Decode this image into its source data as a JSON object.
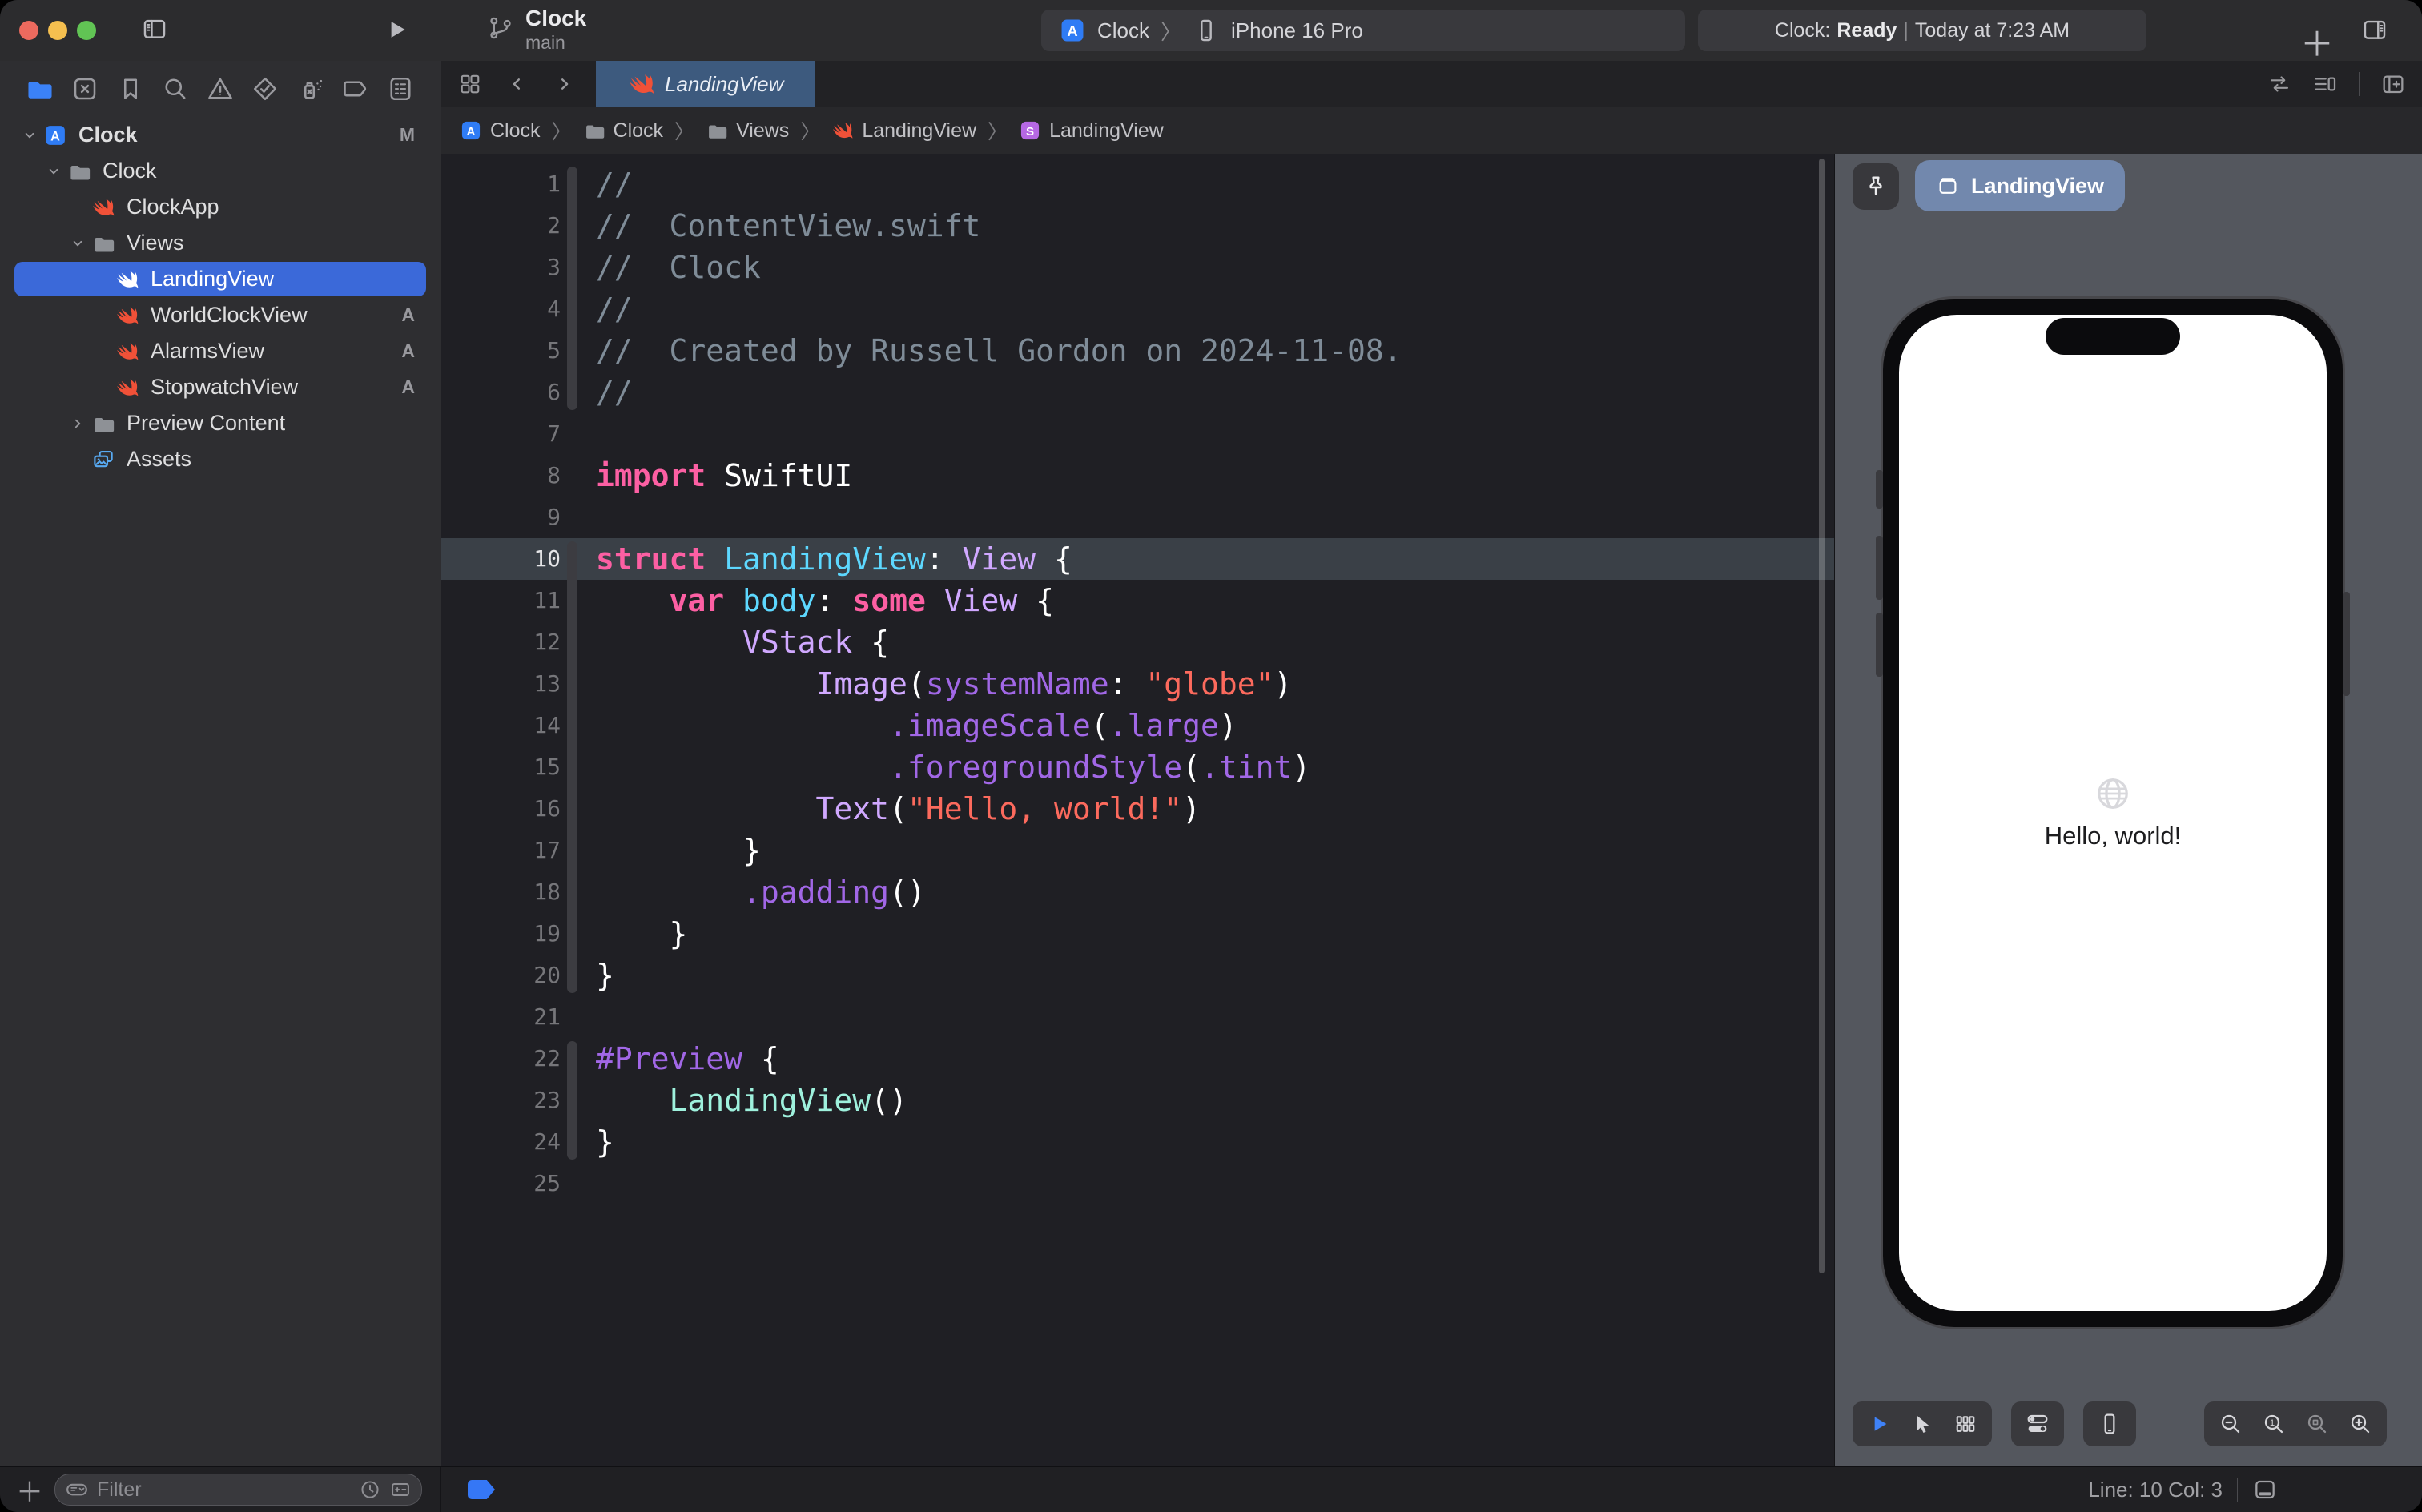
{
  "colors": {
    "syntax": {
      "com": "#7f8c98",
      "kw": "#fc5fa3",
      "decl": "#5dd8ff",
      "type": "#d0a8ff",
      "mem": "#a167e6",
      "str": "#fc6a5d",
      "proj": "#9ef1dd",
      "pl": "#ffffff",
      "ln": "#76767a",
      "ln_hl": "#e6e6e8"
    },
    "traffic": [
      "#ec6a5e",
      "#f5bf4f",
      "#61c454"
    ],
    "swift_orange": "#f05138",
    "folder_gray": "#8e9196",
    "app_blue": "#2f7cf5",
    "assets_blue": "#58aaf2",
    "struct_purple": "#b668e4",
    "selection_blue": "#3b69d9",
    "tab_active": "#3d5a7e",
    "chip_blue": "#7288ad",
    "play_blue": "#3f82f8",
    "globe_blue": "#3478f6"
  },
  "toolbar": {
    "project": "Clock",
    "branch": "main",
    "scheme_target": "Clock",
    "scheme_separator": "〉",
    "scheme_device": "iPhone 16 Pro",
    "status_app": "Clock:",
    "status_state": "Ready",
    "status_sep": "|",
    "status_detail": "Today at 7:23 AM"
  },
  "navigator": {
    "tabs": [
      {
        "name": "project-navigator",
        "active": true
      },
      {
        "name": "source-control-changes"
      },
      {
        "name": "bookmarks"
      },
      {
        "name": "find"
      },
      {
        "name": "issues"
      },
      {
        "name": "tests"
      },
      {
        "name": "debug-memory"
      },
      {
        "name": "breakpoints"
      },
      {
        "name": "reports"
      }
    ],
    "tree": [
      {
        "label": "Clock",
        "icon": "app-project",
        "depth": 0,
        "chevron": "down",
        "badge": "M"
      },
      {
        "label": "Clock",
        "icon": "folder",
        "depth": 1,
        "chevron": "down"
      },
      {
        "label": "ClockApp",
        "icon": "swift",
        "depth": 2
      },
      {
        "label": "Views",
        "icon": "folder",
        "depth": 2,
        "chevron": "down"
      },
      {
        "label": "LandingView",
        "icon": "swift",
        "depth": 3,
        "selected": true
      },
      {
        "label": "WorldClockView",
        "icon": "swift",
        "depth": 3,
        "badge": "A"
      },
      {
        "label": "AlarmsView",
        "icon": "swift",
        "depth": 3,
        "badge": "A"
      },
      {
        "label": "StopwatchView",
        "icon": "swift",
        "depth": 3,
        "badge": "A"
      },
      {
        "label": "Preview Content",
        "icon": "folder",
        "depth": 2,
        "chevron": "right"
      },
      {
        "label": "Assets",
        "icon": "assets",
        "depth": 2
      }
    ],
    "filter_placeholder": "Filter"
  },
  "editor_tabs": {
    "active_tab": {
      "label": "LandingView",
      "icon": "swift"
    }
  },
  "breadcrumb": {
    "separator": "〉",
    "items": [
      {
        "icon": "app-project",
        "label": "Clock"
      },
      {
        "icon": "folder",
        "label": "Clock"
      },
      {
        "icon": "folder",
        "label": "Views"
      },
      {
        "icon": "swift",
        "label": "LandingView"
      },
      {
        "icon": "struct",
        "label": "LandingView"
      }
    ]
  },
  "code": {
    "lines": [
      {
        "n": 1,
        "bar": true,
        "t": [
          [
            "com",
            "//"
          ]
        ]
      },
      {
        "n": 2,
        "bar": true,
        "t": [
          [
            "com",
            "//  ContentView.swift"
          ]
        ]
      },
      {
        "n": 3,
        "bar": true,
        "t": [
          [
            "com",
            "//  Clock"
          ]
        ]
      },
      {
        "n": 4,
        "bar": true,
        "t": [
          [
            "com",
            "//"
          ]
        ]
      },
      {
        "n": 5,
        "bar": true,
        "t": [
          [
            "com",
            "//  Created by Russell Gordon on 2024-11-08."
          ]
        ]
      },
      {
        "n": 6,
        "bar": true,
        "t": [
          [
            "com",
            "//"
          ]
        ]
      },
      {
        "n": 7,
        "t": []
      },
      {
        "n": 8,
        "t": [
          [
            "kw",
            "import"
          ],
          [
            "pl",
            " SwiftUI"
          ]
        ]
      },
      {
        "n": 9,
        "t": []
      },
      {
        "n": 10,
        "hl": true,
        "bar": true,
        "t": [
          [
            "kw",
            "struct"
          ],
          [
            "pl",
            " "
          ],
          [
            "decl",
            "LandingView"
          ],
          [
            "pl",
            ": "
          ],
          [
            "type",
            "View"
          ],
          [
            "pl",
            " {"
          ]
        ]
      },
      {
        "n": 11,
        "bar": true,
        "t": [
          [
            "pl",
            "    "
          ],
          [
            "kw",
            "var"
          ],
          [
            "pl",
            " "
          ],
          [
            "decl",
            "body"
          ],
          [
            "pl",
            ": "
          ],
          [
            "kw",
            "some"
          ],
          [
            "pl",
            " "
          ],
          [
            "type",
            "View"
          ],
          [
            "pl",
            " {"
          ]
        ]
      },
      {
        "n": 12,
        "bar": true,
        "t": [
          [
            "pl",
            "        "
          ],
          [
            "type",
            "VStack"
          ],
          [
            "pl",
            " {"
          ]
        ]
      },
      {
        "n": 13,
        "bar": true,
        "t": [
          [
            "pl",
            "            "
          ],
          [
            "type",
            "Image"
          ],
          [
            "pl",
            "("
          ],
          [
            "mem",
            "systemName"
          ],
          [
            "pl",
            ": "
          ],
          [
            "str",
            "\"globe\""
          ],
          [
            "pl",
            ")"
          ]
        ]
      },
      {
        "n": 14,
        "bar": true,
        "t": [
          [
            "pl",
            "                "
          ],
          [
            "mem",
            ".imageScale"
          ],
          [
            "pl",
            "("
          ],
          [
            "mem",
            ".large"
          ],
          [
            "pl",
            ")"
          ]
        ]
      },
      {
        "n": 15,
        "bar": true,
        "t": [
          [
            "pl",
            "                "
          ],
          [
            "mem",
            ".foregroundStyle"
          ],
          [
            "pl",
            "("
          ],
          [
            "mem",
            ".tint"
          ],
          [
            "pl",
            ")"
          ]
        ]
      },
      {
        "n": 16,
        "bar": true,
        "t": [
          [
            "pl",
            "            "
          ],
          [
            "type",
            "Text"
          ],
          [
            "pl",
            "("
          ],
          [
            "str",
            "\"Hello, world!\""
          ],
          [
            "pl",
            ")"
          ]
        ]
      },
      {
        "n": 17,
        "bar": true,
        "t": [
          [
            "pl",
            "        }"
          ]
        ]
      },
      {
        "n": 18,
        "bar": true,
        "t": [
          [
            "pl",
            "        "
          ],
          [
            "mem",
            ".padding"
          ],
          [
            "pl",
            "()"
          ]
        ]
      },
      {
        "n": 19,
        "bar": true,
        "t": [
          [
            "pl",
            "    }"
          ]
        ]
      },
      {
        "n": 20,
        "bar": true,
        "t": [
          [
            "pl",
            "}"
          ]
        ]
      },
      {
        "n": 21,
        "t": []
      },
      {
        "n": 22,
        "bar": true,
        "t": [
          [
            "mem",
            "#Preview"
          ],
          [
            "pl",
            " {"
          ]
        ]
      },
      {
        "n": 23,
        "bar": true,
        "t": [
          [
            "pl",
            "    "
          ],
          [
            "proj",
            "LandingView"
          ],
          [
            "pl",
            "()"
          ]
        ]
      },
      {
        "n": 24,
        "bar": true,
        "t": [
          [
            "pl",
            "}"
          ]
        ]
      },
      {
        "n": 25,
        "t": []
      }
    ]
  },
  "preview": {
    "chip_label": "LandingView",
    "phone_text": "Hello, world!",
    "toolbar_buttons": [
      "play",
      "pointer",
      "variants"
    ],
    "solo_buttons": [
      "device-settings",
      "device"
    ],
    "zoom_buttons": [
      "zoom-out",
      "zoom-actual",
      "zoom-fit",
      "zoom-in"
    ]
  },
  "statusbar": {
    "position": "Line: 10  Col: 3"
  }
}
